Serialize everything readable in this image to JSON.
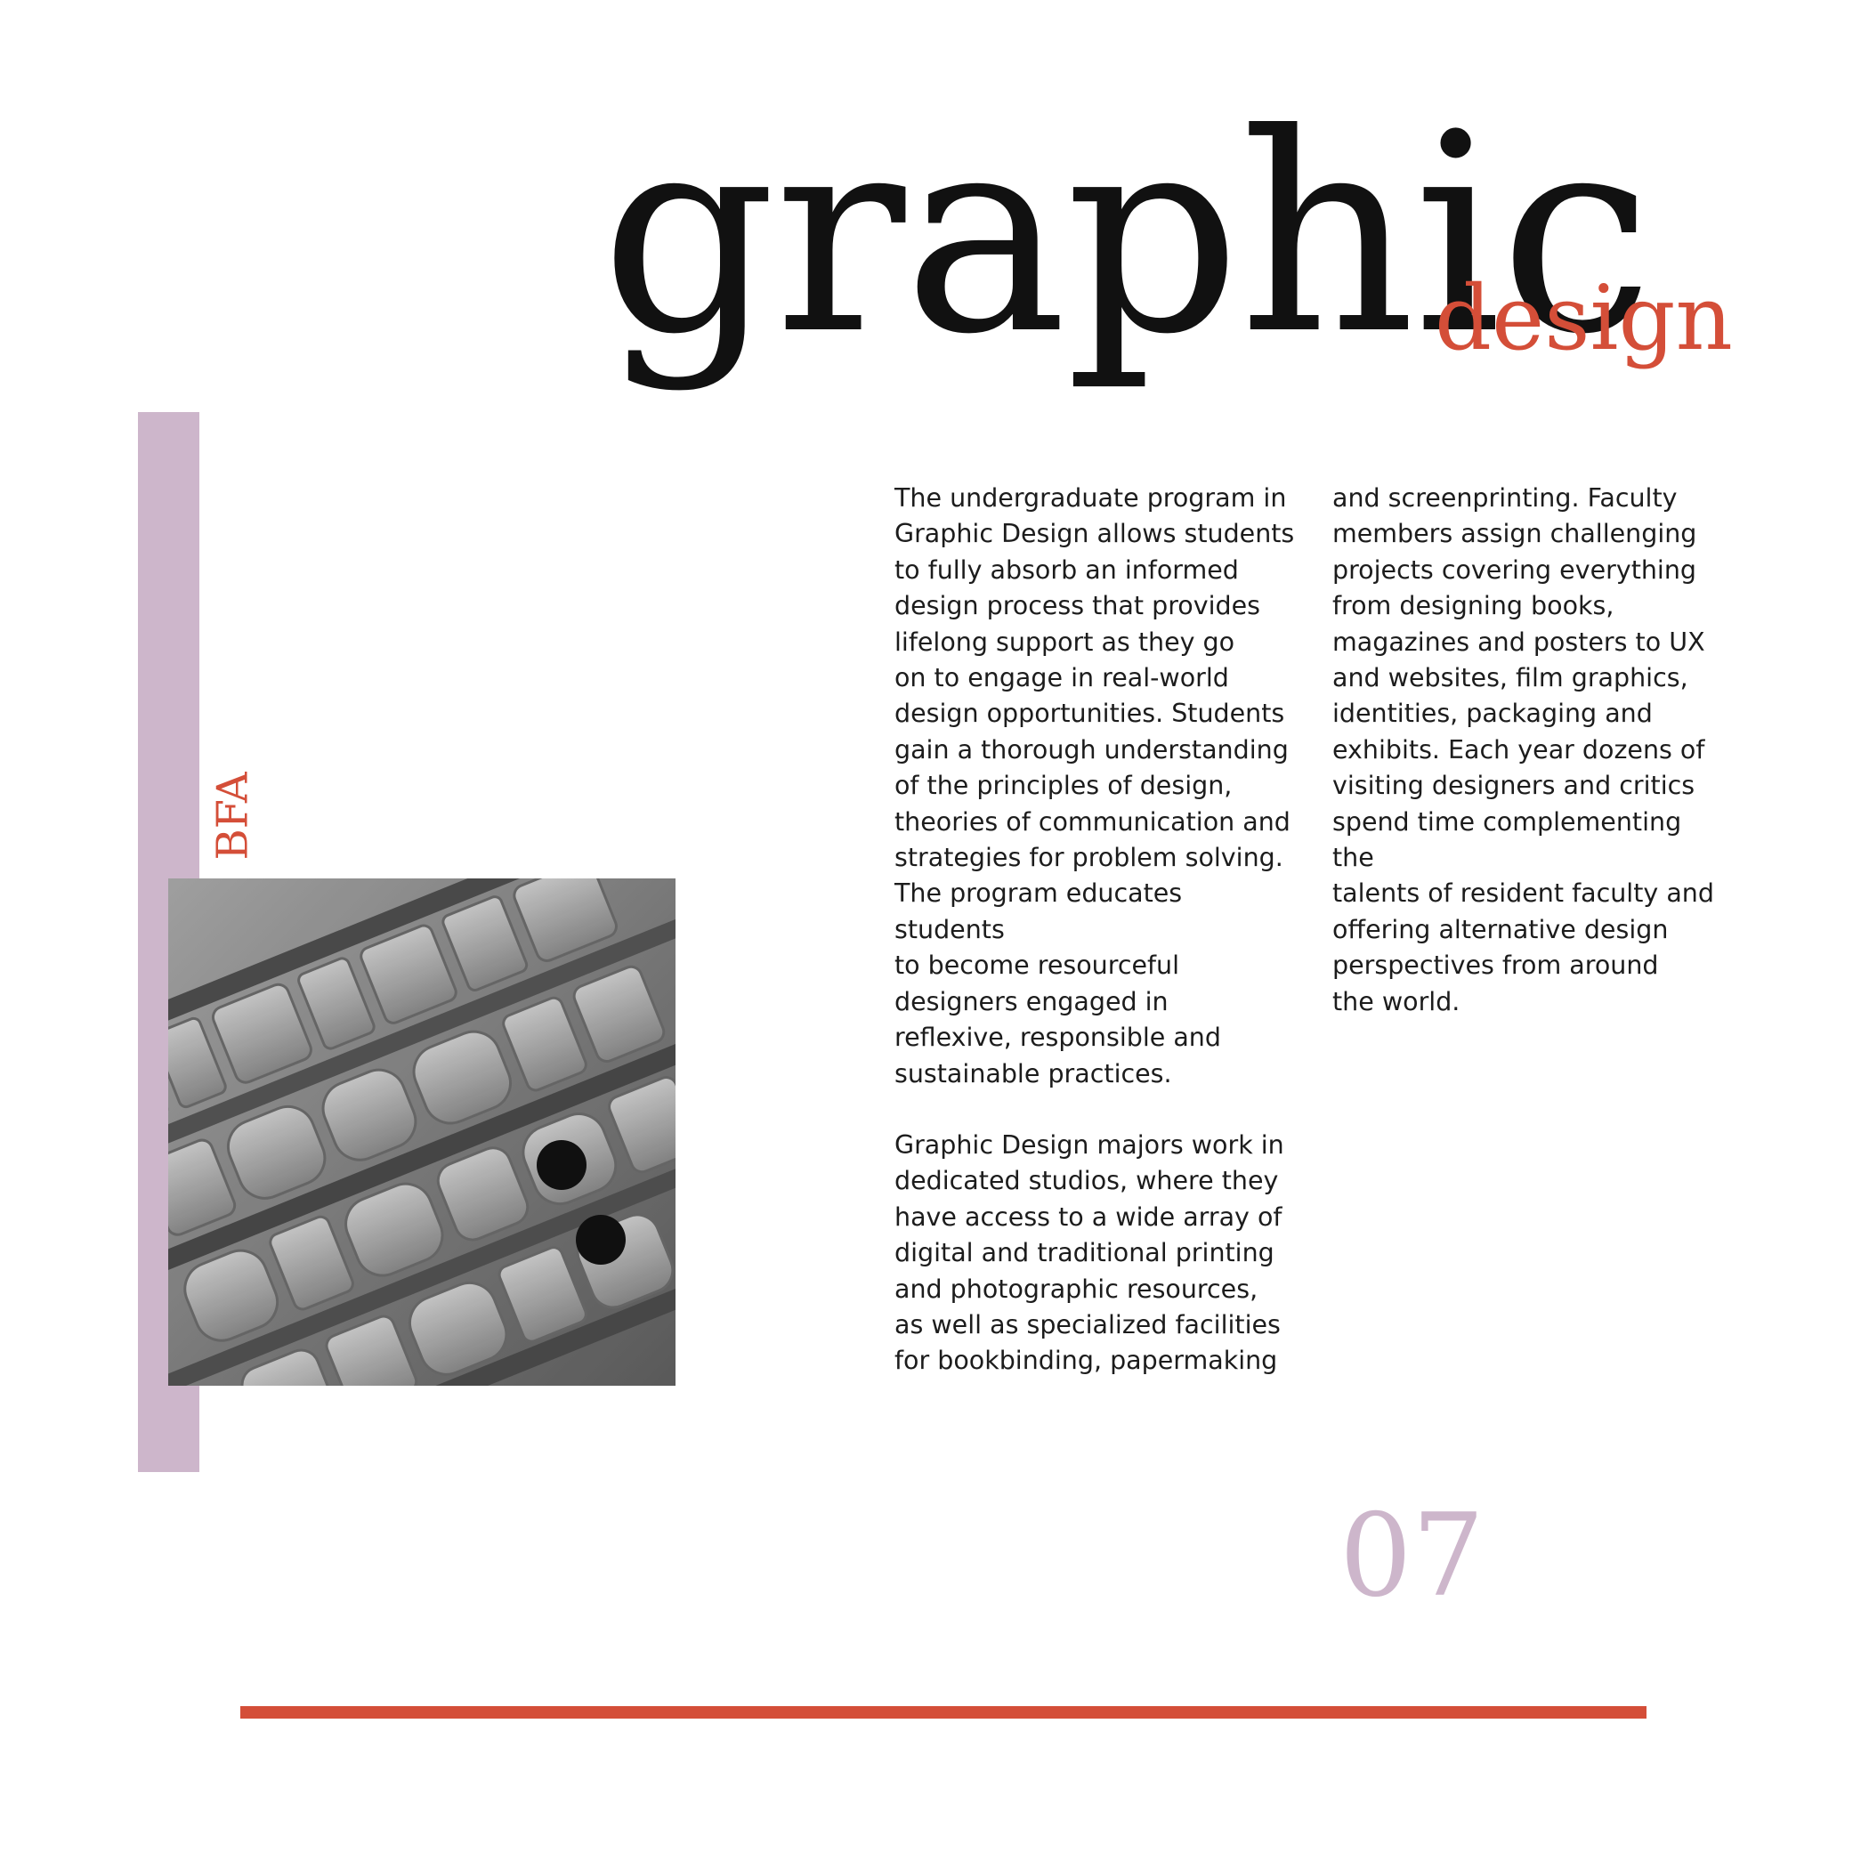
{
  "heading": {
    "main": "graphic",
    "sub": "design"
  },
  "side_label": "BFA",
  "photo": {
    "icon": "letterpress-photo-icon"
  },
  "body": {
    "paragraph_1_lines": "The undergraduate program in\nGraphic Design allows students\nto fully absorb an informed\ndesign process that provides\nlifelong support as they go\non to engage in real-world\ndesign opportunities. Students\ngain a thorough understanding\nof the principles of design,\ntheories of communication and\nstrategies for problem solving.\nThe program educates students\nto become resourceful\ndesigners engaged in\nreflexive, responsible and\nsustainable practices.",
    "paragraph_2_lines": "Graphic Design majors work in\ndedicated studios, where they\nhave access to a wide array of\ndigital and traditional printing\nand photographic resources,\nas well as specialized facilities\nfor bookbinding, papermaking",
    "paragraph_3_lines": "and screenprinting. Faculty\nmembers assign challenging\nprojects covering everything\nfrom designing books,\nmagazines and posters to UX\nand websites, film graphics,\nidentities, packaging and\nexhibits. Each year dozens of\nvisiting designers and critics\nspend time complementing the\ntalents of resident faculty and\noffering alternative design\nperspectives from around\nthe world."
  },
  "page_number": "07",
  "colors": {
    "accent_red": "#d44e38",
    "accent_lilac": "#cdb6cb",
    "text_dark": "#111111"
  }
}
